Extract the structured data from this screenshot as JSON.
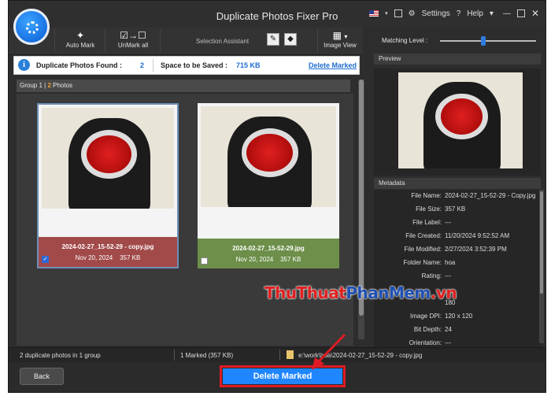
{
  "window": {
    "title": "Duplicate Photos Fixer Pro"
  },
  "titlebar": {
    "settings_label": "Settings",
    "help_label": "Help"
  },
  "toolbar": {
    "auto_mark_label": "Auto Mark",
    "unmark_all_label": "UnMark all",
    "selection_assistant_label": "Selection Assistant",
    "image_view_label": "Image View"
  },
  "info_bar": {
    "duplicates_label": "Duplicate Photos Found :",
    "duplicates_value": "2",
    "space_label": "Space to be Saved :",
    "space_value": "715 KB",
    "delete_link": "Delete Marked"
  },
  "group": {
    "name": "Group 1 |",
    "count": "2",
    "unit": "Photos"
  },
  "photos": [
    {
      "name": "2024-02-27_15-52-29 - copy.jpg",
      "date": "Nov 20, 2024",
      "size": "357 KB",
      "marked": true,
      "caption_color": "#a24a4a"
    },
    {
      "name": "2024-02-27_15-52-29.jpg",
      "date": "Nov 20, 2024",
      "size": "357 KB",
      "marked": false,
      "caption_color": "#6d8f4a"
    }
  ],
  "matching_level": {
    "label": "Matching Level :",
    "value": 0.45
  },
  "preview": {
    "heading": "Preview"
  },
  "metadata": {
    "heading": "Metadata",
    "rows": [
      {
        "key": "File Name:",
        "value": "2024-02-27_15-52-29 - Copy.jpg"
      },
      {
        "key": "File Size:",
        "value": "357 KB"
      },
      {
        "key": "File Label:",
        "value": "---"
      },
      {
        "key": "File Created:",
        "value": "11/20/2024 9:52:52 AM"
      },
      {
        "key": "File Modified:",
        "value": "2/27/2024 3:52:39 PM"
      },
      {
        "key": "Folder Name:",
        "value": "hoa"
      },
      {
        "key": "Rating:",
        "value": "---"
      },
      {
        "key": "",
        "value": "180"
      },
      {
        "key": "Image DPI:",
        "value": "120 x 120"
      },
      {
        "key": "Bit Depth:",
        "value": "24"
      },
      {
        "key": "Orientation:",
        "value": "---"
      }
    ]
  },
  "status": {
    "groups_text": "2 duplicate photos in 1 group",
    "marked_text": "1 Marked (357 KB)",
    "path_text": "e:\\work\\hoa\\2024-02-27_15-52-29 - copy.jpg"
  },
  "footer": {
    "back_label": "Back",
    "delete_label": "Delete Marked"
  },
  "watermark": {
    "part1": "Thu",
    "part2": "Thuat",
    "part3": "Phan",
    "part4": "Mem",
    "part5": ".vn"
  },
  "colors": {
    "accent": "#1f86ff",
    "highlight": "#e01b24",
    "count_orange": "#f0a030"
  }
}
